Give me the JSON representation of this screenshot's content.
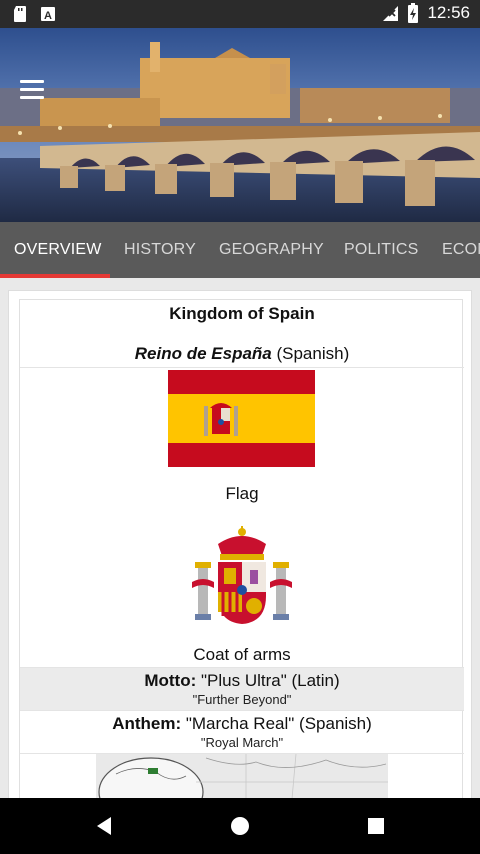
{
  "status_bar": {
    "time": "12:56",
    "icons": [
      "sd-card-icon",
      "a-notification-icon",
      "no-signal-icon",
      "battery-charging-icon"
    ]
  },
  "hero": {
    "image": "cordoba-roman-bridge-photo",
    "menu_icon": "hamburger-menu-icon"
  },
  "tabs": [
    {
      "label": "OVERVIEW",
      "active": true
    },
    {
      "label": "HISTORY",
      "active": false
    },
    {
      "label": "GEOGRAPHY",
      "active": false
    },
    {
      "label": "POLITICS",
      "active": false
    },
    {
      "label": "ECON",
      "active": false
    }
  ],
  "infobox": {
    "title": "Kingdom of Spain",
    "native_name": "Reino de España",
    "native_lang": " (Spanish)",
    "flag_caption": "Flag",
    "coat_caption": "Coat of arms",
    "motto": {
      "label": "Motto:",
      "value": " \"Plus Ultra\" (Latin)",
      "translation": "\"Further Beyond\""
    },
    "anthem": {
      "label": "Anthem:",
      "value": " \"Marcha Real\" (Spanish)",
      "translation": "\"Royal March\""
    }
  },
  "colors": {
    "tab_bar": "#5a5a5a",
    "tab_indicator": "#e53935",
    "flag_red": "#c60b1e",
    "flag_yellow": "#ffc400"
  },
  "nav": {
    "back": "back-triangle-icon",
    "home": "home-circle-icon",
    "recents": "recents-square-icon"
  }
}
